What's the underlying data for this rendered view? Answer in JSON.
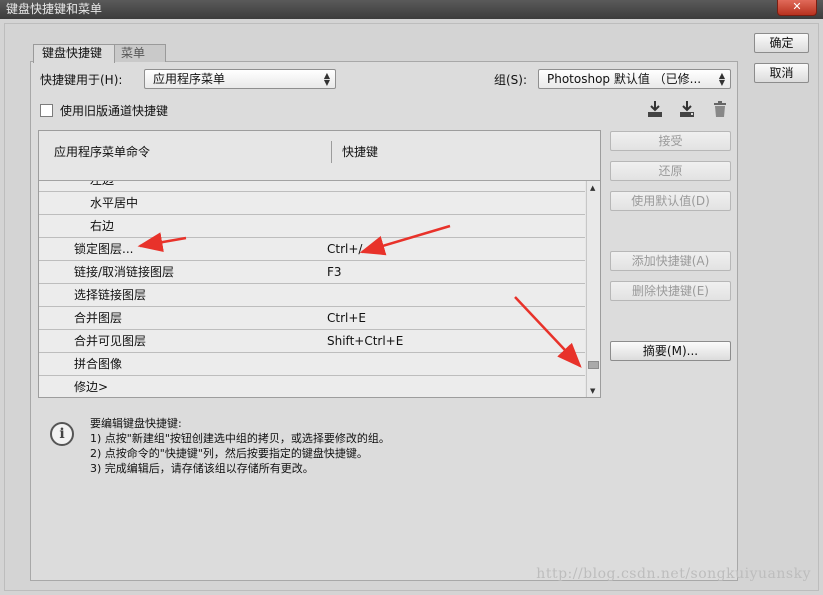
{
  "window": {
    "title": "键盘快捷键和菜单",
    "close_glyph": "✕"
  },
  "buttons": {
    "ok": "确定",
    "cancel": "取消",
    "accept": "接受",
    "revert": "还原",
    "use_default": "使用默认值(D)",
    "add_shortcut": "添加快捷键(A)",
    "delete_shortcut": "删除快捷键(E)",
    "summarize": "摘要(M)..."
  },
  "tabs": [
    {
      "label": "键盘快捷键",
      "active": true
    },
    {
      "label": "菜单",
      "active": false
    }
  ],
  "shortcuts_for": {
    "label": "快捷键用于(H):",
    "value": "应用程序菜单"
  },
  "set": {
    "label": "组(S):",
    "value": "Photoshop 默认值 （已修..."
  },
  "legacy_checkbox": {
    "label": "使用旧版通道快捷键",
    "checked": false
  },
  "icons": {
    "save_set": "save-set-icon",
    "save_set_as": "save-set-as-icon",
    "delete_set": "trash-icon"
  },
  "table": {
    "headers": {
      "command": "应用程序菜单命令",
      "shortcut": "快捷键"
    },
    "rows": [
      {
        "command": "左边",
        "shortcut": "",
        "indent": 2
      },
      {
        "command": "水平居中",
        "shortcut": "",
        "indent": 2
      },
      {
        "command": "右边",
        "shortcut": "",
        "indent": 2
      },
      {
        "command": "锁定图层...",
        "shortcut": "Ctrl+/",
        "indent": 1
      },
      {
        "command": "链接/取消链接图层",
        "shortcut": "F3",
        "indent": 1
      },
      {
        "command": "选择链接图层",
        "shortcut": "",
        "indent": 1
      },
      {
        "command": "合并图层",
        "shortcut": "Ctrl+E",
        "indent": 1
      },
      {
        "command": "合并可见图层",
        "shortcut": "Shift+Ctrl+E",
        "indent": 1
      },
      {
        "command": "拼合图像",
        "shortcut": "",
        "indent": 1
      },
      {
        "command": "修边>",
        "shortcut": "",
        "indent": 1
      }
    ]
  },
  "info": {
    "icon": "info-icon",
    "lines": [
      "要编辑键盘快捷键:",
      "1) 点按\"新建组\"按钮创建选中组的拷贝，或选择要修改的组。",
      "2) 点按命令的\"快捷键\"列，然后按要指定的键盘快捷键。",
      "3) 完成编辑后，请存储该组以存储所有更改。"
    ]
  },
  "watermark": "http://blog.csdn.net/songkuiyuansky",
  "colors": {
    "annotation_arrow": "#e8322a"
  }
}
